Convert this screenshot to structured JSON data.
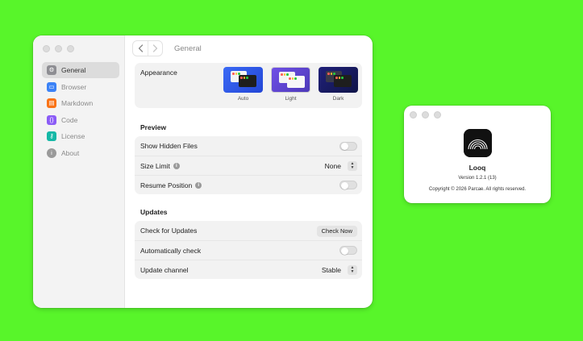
{
  "settings_window": {
    "title": "General",
    "nav_back_icon": "chevron-left-icon",
    "nav_forward_icon": "chevron-right-icon",
    "sidebar": [
      {
        "label": "General",
        "icon": "gear-icon",
        "color": "#8e8e93",
        "active": true
      },
      {
        "label": "Browser",
        "icon": "browser-icon",
        "color": "#3b82f6",
        "active": false
      },
      {
        "label": "Markdown",
        "icon": "markdown-icon",
        "color": "#f97316",
        "active": false
      },
      {
        "label": "Code",
        "icon": "code-icon",
        "color": "#8b5cf6",
        "active": false
      },
      {
        "label": "License",
        "icon": "key-icon",
        "color": "#14b8a6",
        "active": false
      },
      {
        "label": "About",
        "icon": "info-icon",
        "color": "#9a9a9a",
        "active": false
      }
    ],
    "appearance": {
      "label": "Appearance",
      "options": [
        {
          "label": "Auto",
          "selected": false
        },
        {
          "label": "Light",
          "selected": false
        },
        {
          "label": "Dark",
          "selected": false
        }
      ]
    },
    "preview": {
      "title": "Preview",
      "show_hidden_files": {
        "label": "Show Hidden Files",
        "enabled": false
      },
      "size_limit": {
        "label": "Size Limit",
        "value": "None"
      },
      "resume_position": {
        "label": "Resume Position",
        "enabled": false
      }
    },
    "updates": {
      "title": "Updates",
      "check_for_updates": {
        "label": "Check for Updates",
        "button": "Check Now"
      },
      "automatically_check": {
        "label": "Automatically check",
        "enabled": false
      },
      "update_channel": {
        "label": "Update channel",
        "value": "Stable"
      }
    }
  },
  "about_window": {
    "app_name": "Looq",
    "version": "Version 1.2.1 (13)",
    "copyright": "Copyright © 2026 Parcae. All rights reserved."
  },
  "colors": {
    "background": "#58f52a",
    "auto_theme": "#2f5ae8",
    "light_theme": "#6148d8",
    "dark_theme": "#1a1c63"
  }
}
